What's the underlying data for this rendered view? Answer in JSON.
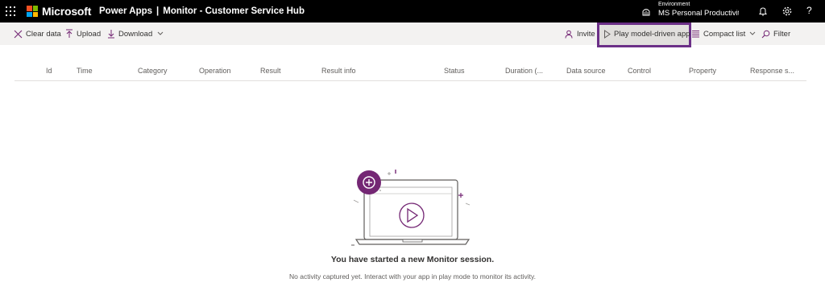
{
  "header": {
    "brand": "Microsoft",
    "product": "Power Apps",
    "separator": "|",
    "page_title": "Monitor - Customer Service Hub",
    "environment_label": "Environment",
    "environment_value": "MS Personal Productivit...",
    "icons": [
      "app-launcher-icon",
      "environment-icon",
      "notifications-icon",
      "settings-icon",
      "help-icon"
    ],
    "help_glyph": "?",
    "logo_colors": [
      "#f25022",
      "#7fba00",
      "#00a4ef",
      "#ffb900"
    ]
  },
  "toolbar": {
    "clear_data": "Clear data",
    "upload": "Upload",
    "download": "Download",
    "invite": "Invite",
    "play_model_driven_app": "Play model-driven app",
    "compact_list": "Compact list",
    "filter": "Filter",
    "highlight_color": "#6b2f87"
  },
  "table": {
    "columns": [
      "Id",
      "Time",
      "Category",
      "Operation",
      "Result",
      "Result info",
      "Status",
      "Duration (...",
      "Data source",
      "Control",
      "Property",
      "Response s..."
    ]
  },
  "empty_state": {
    "title": "You have started a new Monitor session.",
    "subtitle": "No activity captured yet. Interact with your app in play mode to monitor its activity.",
    "accent_color": "#742774"
  }
}
